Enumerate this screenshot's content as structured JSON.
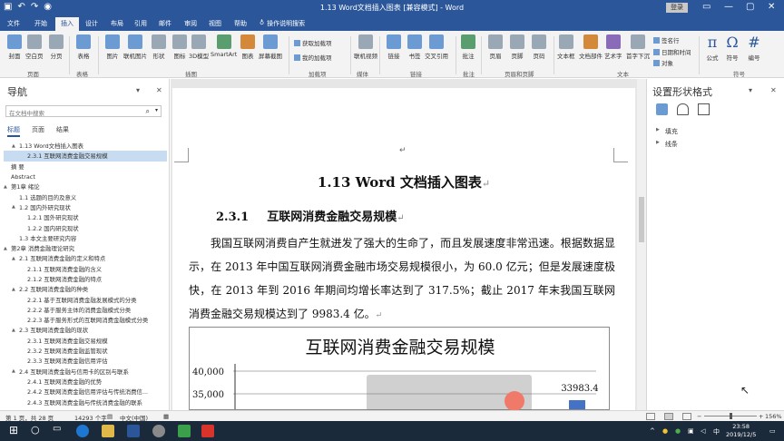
{
  "titlebar": {
    "title": "1.13 Word文档插入图表 [兼容模式] - Word",
    "login_label": "登录",
    "quick_access": [
      "save-icon",
      "undo-icon",
      "redo-icon",
      "touch-mode-icon"
    ]
  },
  "tabs": [
    "文件",
    "开始",
    "插入",
    "设计",
    "布局",
    "引用",
    "邮件",
    "审阅",
    "视图",
    "帮助"
  ],
  "active_tab": "插入",
  "tellme": "操作说明搜索",
  "ribbon": {
    "buttons": [
      "封面",
      "空白页",
      "分页",
      "表格",
      "图片",
      "联机图片",
      "形状",
      "图标",
      "3D模型",
      "SmartArt",
      "图表",
      "屏幕截图",
      "获取加载项",
      "我的加载项",
      "联机视频",
      "链接",
      "书签",
      "交叉引用",
      "批注",
      "页眉",
      "页脚",
      "页码",
      "文本框",
      "文档部件",
      "艺术字",
      "首字下沉",
      "签名行",
      "日期和时间",
      "对象",
      "公式",
      "符号",
      "编号"
    ],
    "groups": [
      "页面",
      "表格",
      "插图",
      "加载项",
      "媒体",
      "链接",
      "批注",
      "页眉和页脚",
      "文本",
      "符号"
    ]
  },
  "nav": {
    "title": "导航",
    "search_placeholder": "在文档中搜索",
    "tabs": [
      "标题",
      "页面",
      "结果"
    ],
    "items": [
      {
        "label": "1.13 Word文档插入图表",
        "level": 1,
        "tri": "▲"
      },
      {
        "label": "2.3.1 互联网消费金融交易规模",
        "level": 2,
        "tri": "",
        "selected": true
      },
      {
        "label": "摘  要",
        "level": 0,
        "tri": ""
      },
      {
        "label": "Abstract",
        "level": 0,
        "tri": ""
      },
      {
        "label": "第1章 绪论",
        "level": 0,
        "tri": "▲"
      },
      {
        "label": "1.1 选题的目的及意义",
        "level": 1,
        "tri": ""
      },
      {
        "label": "1.2 国内外研究现状",
        "level": 1,
        "tri": "▲"
      },
      {
        "label": "1.2.1 国外研究现状",
        "level": 2,
        "tri": ""
      },
      {
        "label": "1.2.2 国内研究现状",
        "level": 2,
        "tri": ""
      },
      {
        "label": "1.3 本文主要研究内容",
        "level": 1,
        "tri": ""
      },
      {
        "label": "第2章 消费金融理论研究",
        "level": 0,
        "tri": "▲"
      },
      {
        "label": "2.1 互联网消费金融的定义和特点",
        "level": 1,
        "tri": "▲"
      },
      {
        "label": "2.1.1 互联网消费金融的含义",
        "level": 2,
        "tri": ""
      },
      {
        "label": "2.1.2 互联网消费金融的特点",
        "level": 2,
        "tri": ""
      },
      {
        "label": "2.2 互联网消费金融的种类",
        "level": 1,
        "tri": "▲"
      },
      {
        "label": "2.2.1 基于互联网消费金融发展模式的分类",
        "level": 2,
        "tri": ""
      },
      {
        "label": "2.2.2 基于服务主体的消费金融模式分类",
        "level": 2,
        "tri": ""
      },
      {
        "label": "2.2.3 基于服务形式的互联网消费金融模式分类",
        "level": 2,
        "tri": ""
      },
      {
        "label": "2.3 互联网消费金融的现状",
        "level": 1,
        "tri": "▲"
      },
      {
        "label": "2.3.1 互联网消费金融交易规模",
        "level": 2,
        "tri": ""
      },
      {
        "label": "2.3.2 互联网消费金融监管现状",
        "level": 2,
        "tri": ""
      },
      {
        "label": "2.3.3 互联网消费金融信用评估",
        "level": 2,
        "tri": ""
      },
      {
        "label": "2.4 互联网消费金融与信用卡的区别与联系",
        "level": 1,
        "tri": "▲"
      },
      {
        "label": "2.4.1 互联网消费金融的优势",
        "level": 2,
        "tri": ""
      },
      {
        "label": "2.4.2 互联网消费金融信用评估与传统消费信...",
        "level": 2,
        "tri": ""
      },
      {
        "label": "2.4.3 互联网消费金融与传统消费金融的联系",
        "level": 2,
        "tri": ""
      }
    ]
  },
  "document": {
    "title": "1.13 Word 文档插入图表",
    "heading_num": "2.3.1",
    "heading_text": "互联网消费金融交易规模",
    "para_mark": "↵",
    "body": "我国互联网消费自产生就迸发了强大的生命了，而且发展速度非常迅速。根据数据显示，在 2013 年中国互联网消费金融市场交易规模很小，为 60.0 亿元；但是发展速度极快，在 2013 年到 2016 年期间均增长率达到了 317.5%；截止 2017 年末我国互联网消费金融交易规模达到了 9983.4 亿。"
  },
  "chart_data": {
    "type": "bar",
    "title": "互联网消费金融交易规模",
    "yticks": [
      "40,000",
      "35,000"
    ],
    "visible_data_labels": [
      "33983.4"
    ],
    "bar_color": "#4472c4",
    "note": ""
  },
  "format_pane": {
    "title": "设置形状格式",
    "icons": [
      "fill-line-icon",
      "effects-icon",
      "size-properties-icon"
    ],
    "sections": [
      "填充",
      "线条"
    ]
  },
  "status": {
    "page": "第 1 页，共 28 页",
    "words": "14293 个字",
    "language": "中文(中国)",
    "zoom": "156%"
  },
  "taskbar": {
    "time": "23:58",
    "date": "2019/12/5",
    "ime": "中"
  },
  "colors": {
    "accent": "#2b579a",
    "selected_nav": "#c7dcf0"
  }
}
